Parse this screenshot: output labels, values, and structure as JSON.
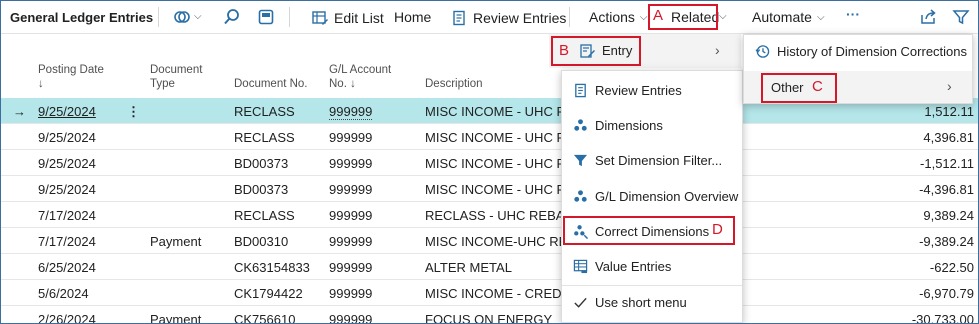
{
  "toolbar": {
    "title": "General Ledger Entries",
    "edit_list": "Edit List",
    "home": "Home",
    "review_entries": "Review Entries",
    "actions": "Actions",
    "related": "Related",
    "automate": "Automate",
    "more": "···"
  },
  "columns": {
    "posting_date": "Posting Date",
    "posting_date_sort": "↓",
    "document_type_1": "Document",
    "document_type_2": "Type",
    "document_no": "Document No.",
    "gl_account_1": "G/L Account",
    "gl_account_2": "No. ↓",
    "description": "Description"
  },
  "rows": [
    {
      "date": "9/25/2024",
      "type": "",
      "doc": "RECLASS",
      "acct": "999999",
      "desc": "MISC INCOME - UHC RI",
      "amount": "1,512.11"
    },
    {
      "date": "9/25/2024",
      "type": "",
      "doc": "RECLASS",
      "acct": "999999",
      "desc": "MISC INCOME - UHC RI",
      "amount": "4,396.81"
    },
    {
      "date": "9/25/2024",
      "type": "",
      "doc": "BD00373",
      "acct": "999999",
      "desc": "MISC INCOME - UHC RI",
      "amount": "-1,512.11"
    },
    {
      "date": "9/25/2024",
      "type": "",
      "doc": "BD00373",
      "acct": "999999",
      "desc": "MISC INCOME - UHC RI",
      "amount": "-4,396.81"
    },
    {
      "date": "7/17/2024",
      "type": "",
      "doc": "RECLASS",
      "acct": "999999",
      "desc": "RECLASS - UHC REBATE",
      "amount": "9,389.24"
    },
    {
      "date": "7/17/2024",
      "type": "Payment",
      "doc": "BD00310",
      "acct": "999999",
      "desc": "MISC INCOME-UHC REI",
      "amount": "-9,389.24"
    },
    {
      "date": "6/25/2024",
      "type": "",
      "doc": "CK63154833",
      "acct": "999999",
      "desc": "ALTER METAL",
      "amount": "-622.50"
    },
    {
      "date": "5/6/2024",
      "type": "",
      "doc": "CK1794422",
      "acct": "999999",
      "desc": "MISC INCOME - CREDIT",
      "amount": "-6,970.79"
    },
    {
      "date": "2/26/2024",
      "type": "Payment",
      "doc": "CK756610",
      "acct": "999999",
      "desc": "FOCUS ON ENERGY",
      "amount": "-30,733.00"
    }
  ],
  "row_menu_icon": "⋮",
  "row_arrow": "→",
  "related_menu": {
    "entry": "Entry",
    "other": "Other"
  },
  "entry_menu": {
    "items": [
      "Review Entries",
      "Dimensions",
      "Set Dimension Filter...",
      "G/L Dimension Overview",
      "Correct Dimensions",
      "Value Entries",
      "Use short menu"
    ]
  },
  "other_menu": {
    "history": "History of Dimension Corrections"
  },
  "annotations": {
    "a": "A",
    "b": "B",
    "c": "C",
    "d": "D"
  },
  "colors": {
    "selected_row": "#b4e6ea",
    "highlight_red": "#d4182a",
    "icon_blue": "#2a6ea6"
  }
}
